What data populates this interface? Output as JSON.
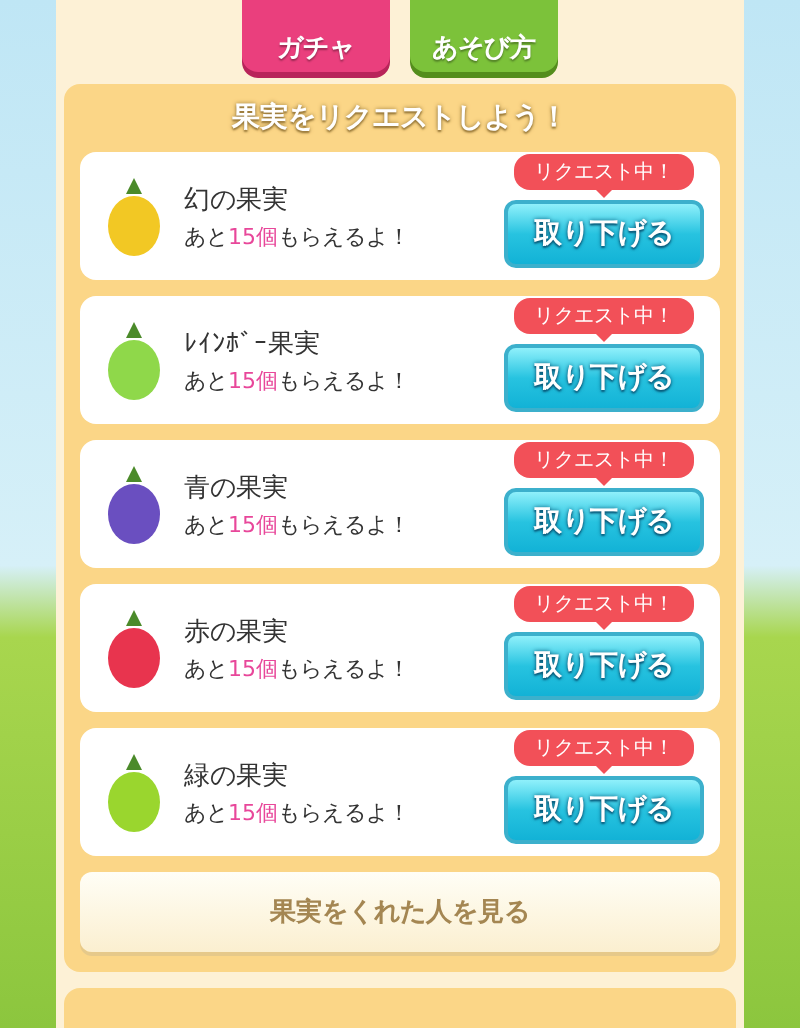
{
  "top_buttons": [
    {
      "label": "ガチャ",
      "kind": "gacha"
    },
    {
      "label": "あそび方",
      "kind": "guide"
    }
  ],
  "panel": {
    "title": "果実をリクエストしよう！"
  },
  "requests": [
    {
      "name": "幻の果実",
      "prefix": "あと",
      "count": "15個",
      "suffix": "もらえるよ！",
      "color": "#f2c824",
      "badge": "リクエスト中！",
      "button": "取り下げる"
    },
    {
      "name": "ﾚｲﾝﾎﾞｰ果実",
      "prefix": "あと",
      "count": "15個",
      "suffix": "もらえるよ！",
      "color": "#8fd84a",
      "badge": "リクエスト中！",
      "button": "取り下げる"
    },
    {
      "name": "青の果実",
      "prefix": "あと",
      "count": "15個",
      "suffix": "もらえるよ！",
      "color": "#6a4fc0",
      "badge": "リクエスト中！",
      "button": "取り下げる"
    },
    {
      "name": "赤の果実",
      "prefix": "あと",
      "count": "15個",
      "suffix": "もらえるよ！",
      "color": "#e8344e",
      "badge": "リクエスト中！",
      "button": "取り下げる"
    },
    {
      "name": "緑の果実",
      "prefix": "あと",
      "count": "15個",
      "suffix": "もらえるよ！",
      "color": "#9ad62e",
      "badge": "リクエスト中！",
      "button": "取り下げる"
    }
  ],
  "footer_button": "果実をくれた人を見る"
}
